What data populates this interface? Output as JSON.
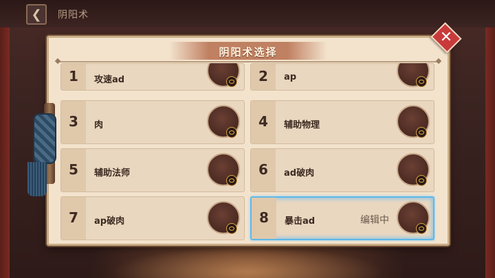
{
  "page": {
    "title": "阴阳术",
    "back_icon": "back-arrow-icon"
  },
  "dialog": {
    "title": "阴阳术选择",
    "close_label": "✕"
  },
  "slots": [
    {
      "num": "1",
      "name": "攻速ad",
      "status": ""
    },
    {
      "num": "2",
      "name": "ap",
      "status": ""
    },
    {
      "num": "3",
      "name": "肉",
      "status": ""
    },
    {
      "num": "4",
      "name": "辅助物理",
      "status": ""
    },
    {
      "num": "5",
      "name": "辅助法师",
      "status": ""
    },
    {
      "num": "6",
      "name": "ad破肉",
      "status": ""
    },
    {
      "num": "7",
      "name": "ap破肉",
      "status": ""
    },
    {
      "num": "8",
      "name": "暴击ad",
      "status": "编辑中"
    }
  ],
  "colors": {
    "accent_active": "#5fb8e8",
    "close_red": "#c93a3a"
  }
}
